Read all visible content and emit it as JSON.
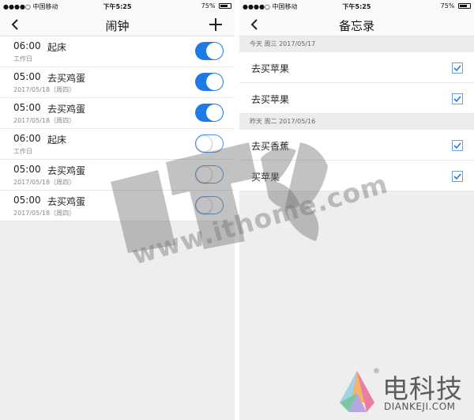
{
  "status_bar": {
    "carrier": "●●●●○ 中国移动",
    "time": "下午5:25",
    "battery": "75%",
    "battery_level": 0.75
  },
  "alarm_screen": {
    "title": "闹钟",
    "alarms": [
      {
        "time": "06:00",
        "name": "起床",
        "repeat": "工作日",
        "enabled": true
      },
      {
        "time": "05:00",
        "name": "去买鸡蛋",
        "repeat": "2017/05/18（周四）",
        "enabled": true
      },
      {
        "time": "05:00",
        "name": "去买鸡蛋",
        "repeat": "2017/05/18（周四）",
        "enabled": true
      },
      {
        "time": "06:00",
        "name": "起床",
        "repeat": "工作日",
        "enabled": false
      },
      {
        "time": "05:00",
        "name": "去买鸡蛋",
        "repeat": "2017/05/18（周四）",
        "enabled": false
      },
      {
        "time": "05:00",
        "name": "去买鸡蛋",
        "repeat": "2017/05/18（周四）",
        "enabled": false
      }
    ]
  },
  "memo_screen": {
    "title": "备忘录",
    "groups": [
      {
        "header": "今天   周三  2017/05/17",
        "items": [
          {
            "text": "去买苹果",
            "checked": true
          },
          {
            "text": "去买苹果",
            "checked": true
          }
        ]
      },
      {
        "header": "昨天   周二  2017/05/16",
        "items": [
          {
            "text": "去买香蕉",
            "checked": true
          },
          {
            "text": "买苹果",
            "checked": true
          }
        ]
      }
    ]
  },
  "watermark": {
    "url": "www.ithome.com"
  },
  "branding": {
    "name": "电科技",
    "url": "DIANKEJI.COM",
    "registered": "®"
  },
  "colors": {
    "accent": "#1f7ae6",
    "background": "#eeeeee",
    "nav_bg": "#fafafa",
    "section_bg": "#ececec"
  }
}
